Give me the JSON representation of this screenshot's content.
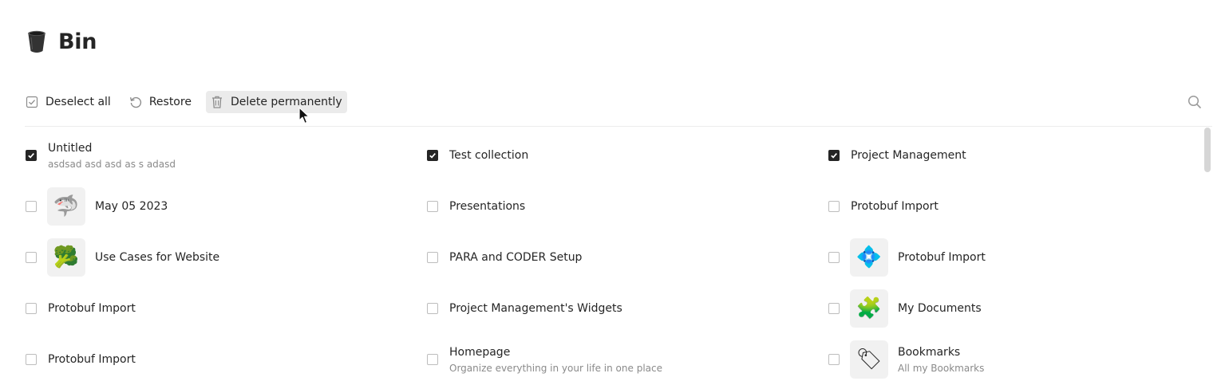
{
  "header": {
    "icon": "trash-bin-icon",
    "title": "Bin"
  },
  "toolbar": {
    "deselect_label": "Deselect all",
    "restore_label": "Restore",
    "delete_label": "Delete permanently"
  },
  "items": [
    {
      "name": "Untitled",
      "description": "asdsad asd asd as s adasd",
      "checked": true
    },
    {
      "name": "Test collection",
      "checked": true
    },
    {
      "name": "Project Management",
      "checked": true
    },
    {
      "name": "May 05 2023",
      "icon": "shark-icon",
      "checked": false
    },
    {
      "name": "Presentations",
      "checked": false
    },
    {
      "name": "Protobuf Import",
      "checked": false
    },
    {
      "name": "Use Cases for Website",
      "icon": "broccoli-icon",
      "checked": false
    },
    {
      "name": "PARA and CODER Setup",
      "checked": false
    },
    {
      "name": "Protobuf Import",
      "icon": "diamond-grid-icon",
      "checked": false
    },
    {
      "name": "Protobuf Import",
      "checked": false
    },
    {
      "name": "Project Management's Widgets",
      "checked": false
    },
    {
      "name": "My Documents",
      "icon": "puzzle-piece-icon",
      "checked": false
    },
    {
      "name": "Protobuf Import",
      "checked": false
    },
    {
      "name": "Homepage",
      "description": "Organize everything in your life in one place",
      "checked": false
    },
    {
      "name": "Bookmarks",
      "description": "All my Bookmarks",
      "icon": "tag-icon",
      "checked": false
    }
  ]
}
